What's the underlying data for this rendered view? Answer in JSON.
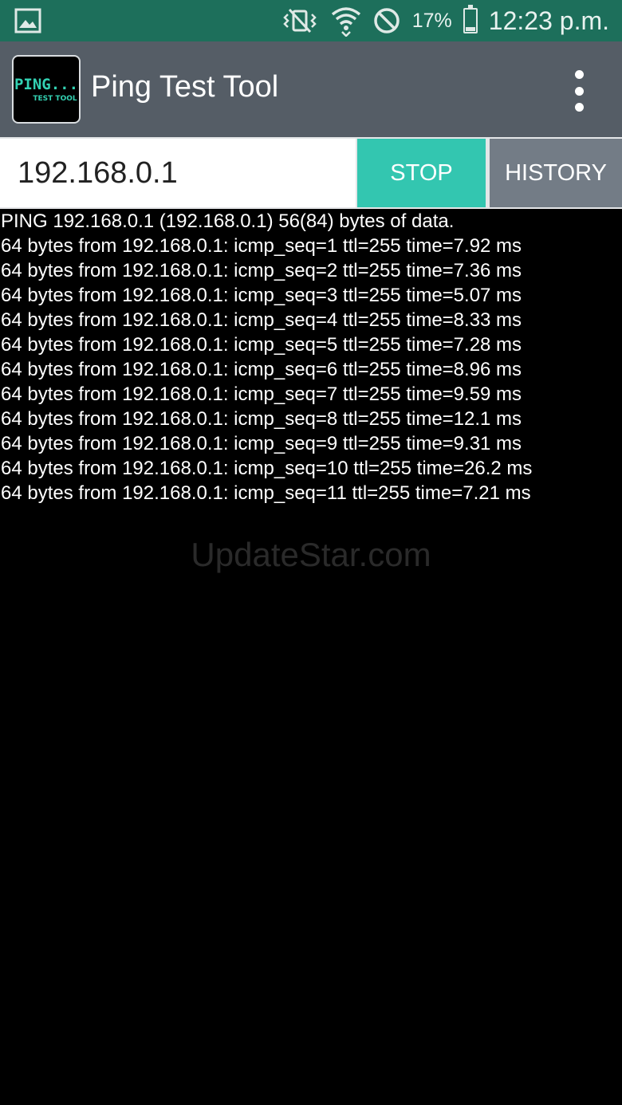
{
  "status_bar": {
    "left_icon": "gallery-image-icon",
    "icons": [
      "vibrate-mute-icon",
      "wifi-icon",
      "do-not-disturb-icon"
    ],
    "battery_percent": "17%",
    "battery_level": 0.17,
    "time": "12:23 p.m."
  },
  "app_bar": {
    "logo_text": "PING...",
    "logo_subtext": "TEST TOOL",
    "title": "Ping Test Tool",
    "overflow_icon": "more-vertical-icon"
  },
  "input": {
    "host_value": "192.168.0.1",
    "stop_label": "STOP",
    "history_label": "HISTORY"
  },
  "output": {
    "lines": [
      "PING 192.168.0.1 (192.168.0.1) 56(84) bytes of data.",
      "64 bytes from 192.168.0.1: icmp_seq=1 ttl=255 time=7.92 ms",
      "64 bytes from 192.168.0.1: icmp_seq=2 ttl=255 time=7.36 ms",
      "64 bytes from 192.168.0.1: icmp_seq=3 ttl=255 time=5.07 ms",
      "64 bytes from 192.168.0.1: icmp_seq=4 ttl=255 time=8.33 ms",
      "64 bytes from 192.168.0.1: icmp_seq=5 ttl=255 time=7.28 ms",
      "64 bytes from 192.168.0.1: icmp_seq=6 ttl=255 time=8.96 ms",
      "64 bytes from 192.168.0.1: icmp_seq=7 ttl=255 time=9.59 ms",
      "64 bytes from 192.168.0.1: icmp_seq=8 ttl=255 time=12.1 ms",
      "64 bytes from 192.168.0.1: icmp_seq=9 ttl=255 time=9.31 ms",
      "64 bytes from 192.168.0.1: icmp_seq=10 ttl=255 time=26.2 ms",
      "64 bytes from 192.168.0.1: icmp_seq=11 ttl=255 time=7.21 ms"
    ]
  },
  "watermark": "UpdateStar.com",
  "colors": {
    "status_bar": "#1d6f5b",
    "app_bar": "#555d66",
    "stop_button": "#33c6b0",
    "history_button": "#737c86",
    "logo_accent": "#33d2b3"
  }
}
